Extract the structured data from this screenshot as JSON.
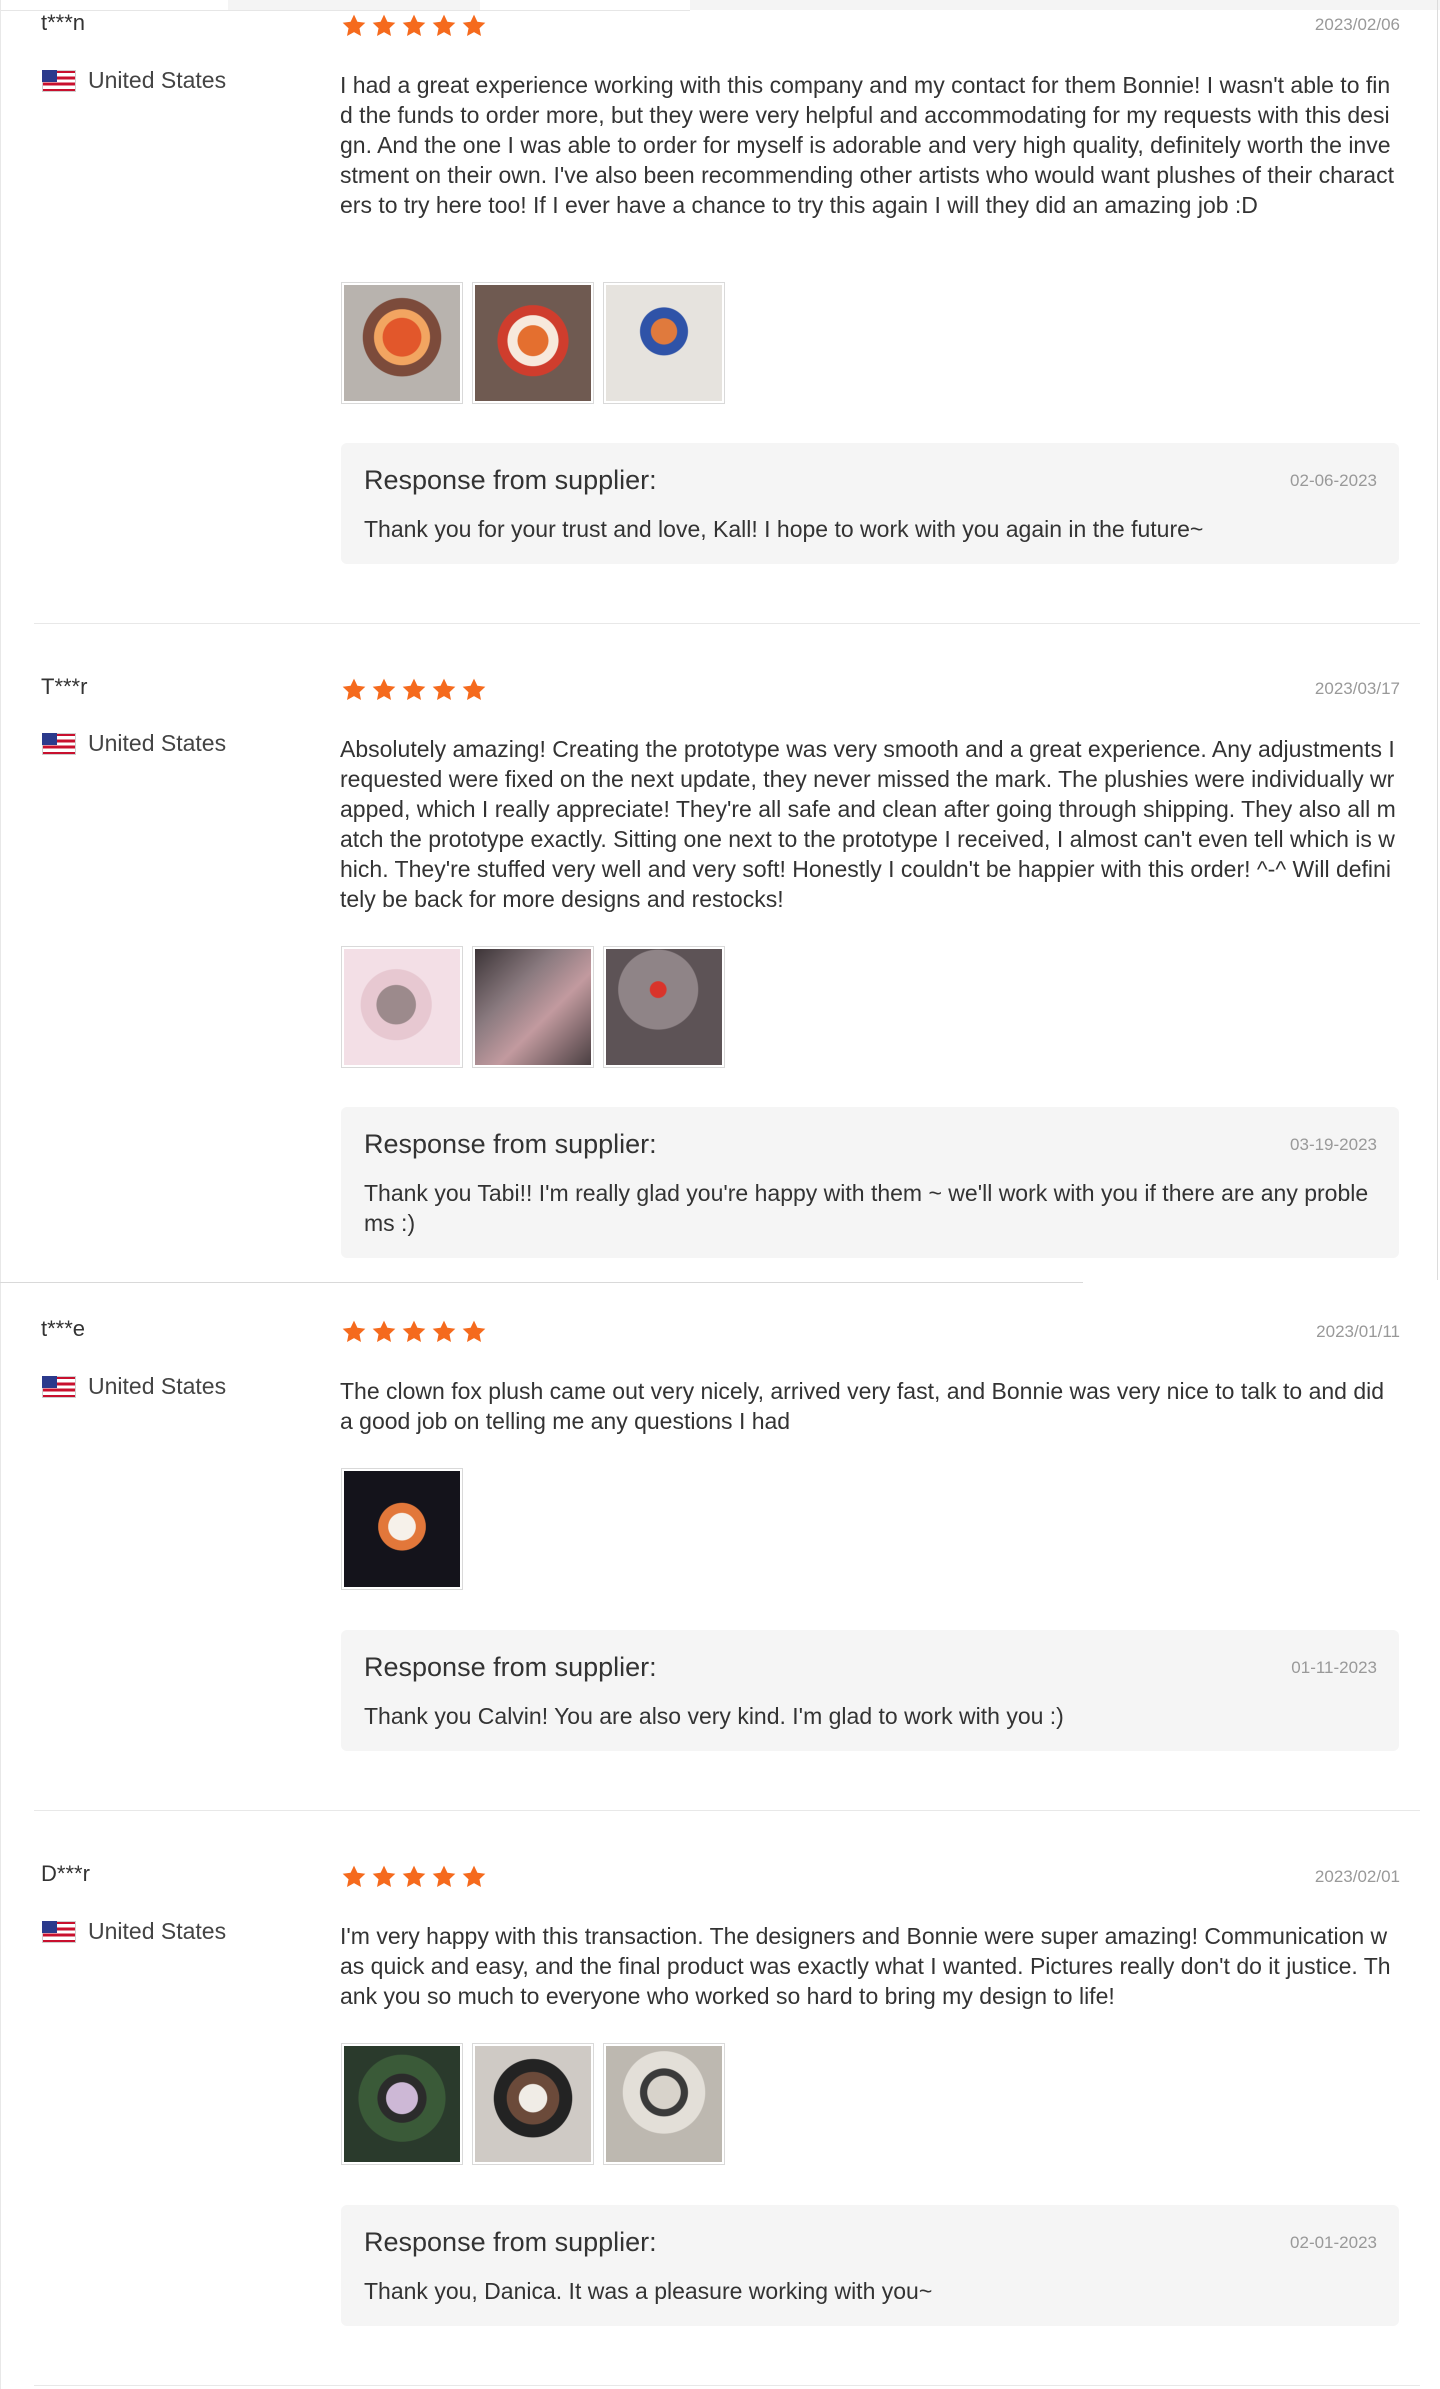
{
  "reviews": [
    {
      "name": "t***n",
      "country": "United States",
      "rating": 5,
      "date": "2023/02/06",
      "content": "I had a great experience working with this company and my contact for them Bonnie! I wasn't able to find the funds to order more, but they were very helpful and accommodating for my requests with this design. And the one I was able to order for myself is adorable and very high quality, definitely worth the investment on their own. I've also been recommending other artists who would want plushes of their characters to try here too! If I ever have a chance to try this again I will they did an amazing job :D",
      "images": [
        "tiger-plush-photo",
        "tiger-plush-photo",
        "tiger-plush-photo"
      ],
      "response": {
        "title": "Response from supplier:",
        "date": "02-06-2023",
        "text": "Thank you for your trust and love, Kall! I hope to work with you again in the future~"
      }
    },
    {
      "name": "T***r",
      "country": "United States",
      "rating": 5,
      "date": "2023/03/17",
      "content": "Absolutely amazing! Creating the prototype was very smooth and a great experience. Any adjustments I requested were fixed on the next update, they never missed the mark. The plushies were individually wrapped, which I really appreciate! They're all safe and clean after going through shipping. They also all match the prototype exactly. Sitting one next to the prototype I received, I almost can't even tell which is which. They're stuffed very well and very soft! Honestly I couldn't be happier with this order! ^-^ Will definitely be back for more designs and restocks!",
      "images": [
        "mouse-plush-photo",
        "plush-batch-photo",
        "wrapped-plush-photo"
      ],
      "response": {
        "title": "Response from supplier:",
        "date": "03-19-2023",
        "text": "Thank you Tabi!! I'm really glad you're happy with them ~ we'll work with you if there are any problems :)"
      }
    },
    {
      "name": "t***e",
      "country": "United States",
      "rating": 5,
      "date": "2023/01/11",
      "content": "The clown fox plush came out very nicely, arrived very fast, and Bonnie was very nice to talk to and did a good job on telling me any questions I had",
      "images": [
        "clown-fox-plush-photo"
      ],
      "response": {
        "title": "Response from supplier:",
        "date": "01-11-2023",
        "text": "Thank you Calvin! You are also very kind. I'm glad to work with you :)"
      }
    },
    {
      "name": "D***r",
      "country": "United States",
      "rating": 5,
      "date": "2023/02/01",
      "content": "I'm very happy with this transaction. The designers and Bonnie were super amazing! Communication was quick and easy, and the final product was exactly what I wanted. Pictures really don't do it justice. Thank you so much to everyone who worked so hard to bring my design to life!",
      "images": [
        "striped-plush-photo",
        "bear-plush-photo",
        "doll-plush-photo"
      ],
      "response": {
        "title": "Response from supplier:",
        "date": "02-01-2023",
        "text": "Thank you, Danica. It was a pleasure working with you~"
      }
    }
  ],
  "colors": {
    "star": "#f56a1d",
    "date_text": "#999999",
    "response_bg": "#f5f5f5",
    "flag_red": "#c8102e",
    "flag_blue": "#2b3a8c"
  },
  "icons": {
    "star": "star-icon",
    "flag": "us-flag-icon"
  }
}
